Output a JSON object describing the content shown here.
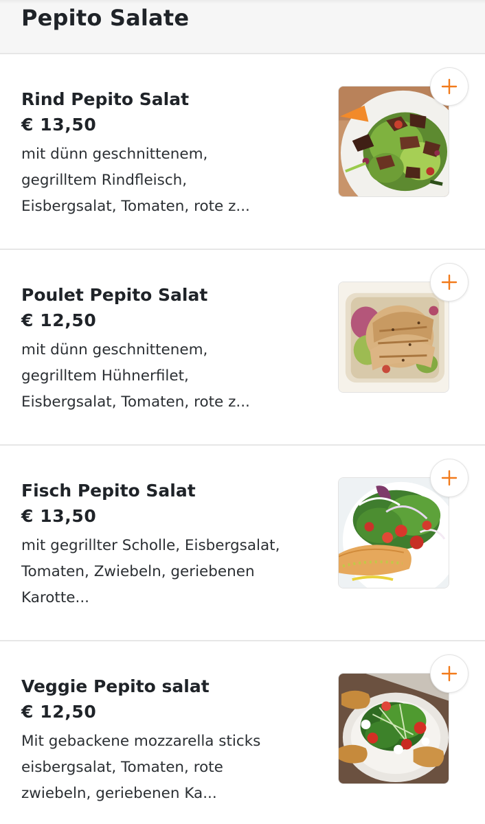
{
  "header": {
    "title": "Pepito Salate"
  },
  "colors": {
    "accent": "#f27a1a",
    "text": "#1f2328",
    "divider": "#e6e6e6",
    "header_bg": "#f6f6f6"
  },
  "items": [
    {
      "name": "Rind Pepito Salat",
      "price": "€ 13,50",
      "description": "mit dünn geschnittenem, gegrilltem Rindfleisch, Eisbergsalat, Tomaten, rote z...",
      "image_icon": "beef-salad-image",
      "add_icon": "plus-icon"
    },
    {
      "name": "Poulet Pepito Salat",
      "price": "€ 12,50",
      "description": "mit dünn geschnittenem, gegrilltem Hühnerfilet, Eisbergsalat, Tomaten, rote z...",
      "image_icon": "chicken-salad-image",
      "add_icon": "plus-icon"
    },
    {
      "name": "Fisch Pepito Salat",
      "price": "€ 13,50",
      "description": "mit gegrillter Scholle, Eisbergsalat, Tomaten, Zwiebeln, geriebenen Karotte...",
      "image_icon": "fish-salad-image",
      "add_icon": "plus-icon"
    },
    {
      "name": "Veggie Pepito salat",
      "price": "€ 12,50",
      "description": "Mit gebackene mozzarella sticks eisbergsalat, Tomaten, rote zwiebeln, geriebenen Ka...",
      "image_icon": "veggie-salad-image",
      "add_icon": "plus-icon"
    }
  ]
}
